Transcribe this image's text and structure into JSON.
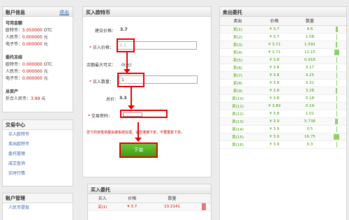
{
  "account": {
    "title": "账户信息",
    "logout": "退出",
    "avail_title": "可用金额",
    "avail_rows": [
      {
        "label": "欧特币：",
        "value": "5.050000",
        "unit": "OTC"
      },
      {
        "label": "人民币：",
        "value": "0.000000",
        "unit": "元"
      },
      {
        "label": "电子币：",
        "value": "0.000000",
        "unit": "元"
      }
    ],
    "frozen_title": "委托冻结",
    "frozen_rows": [
      {
        "label": "欧特币：",
        "value": "0.000000",
        "unit": "OTC"
      },
      {
        "label": "人民币：",
        "value": "0.000000",
        "unit": "元"
      },
      {
        "label": "电子币：",
        "value": "0.000000",
        "unit": "元"
      }
    ],
    "total_title": "总资产",
    "total_label": "折合人民币：",
    "total_value": "3.99",
    "total_unit": "元"
  },
  "trade_center": {
    "title": "交易中心",
    "items": [
      "买入欧特币",
      "卖出欧特币",
      "委托管理",
      "成交查询",
      "实时行情"
    ]
  },
  "account_mgmt": {
    "title": "账户管理",
    "items": [
      "人民币提现"
    ]
  },
  "buy_form": {
    "title": "买入欧特币",
    "suggest_label": "建议价格：",
    "suggest_value": "3.7",
    "price_label": "买入价格：",
    "price_value": "3.3",
    "max_label": "余额最大可买：",
    "max_value": "0(元)",
    "qty_label": "买入数量：",
    "qty_value": "1",
    "total_label": "总价：",
    "total_value": "3.3",
    "pwd_label": "交易密码：",
    "notice": "您下的单笔单都会被系统处理，请您谨慎下单，不要重复下单。",
    "submit": "下单"
  },
  "buy_orders": {
    "title": "买入委托",
    "headers": [
      "买入",
      "价格",
      "数量"
    ],
    "rows": [
      {
        "name": "买(1)",
        "price": "¥ 3.7",
        "qty": "13.2141"
      }
    ]
  },
  "sell_orders": {
    "title": "卖出委托",
    "headers": [
      "卖出",
      "价格",
      "数量"
    ],
    "rows": [
      {
        "name": "卖(1)",
        "price": "¥ 3.7",
        "qty": "4.6"
      },
      {
        "name": "卖(2)",
        "price": "¥ 3.7",
        "qty": "1.08"
      },
      {
        "name": "卖(3)",
        "price": "¥ 3.71",
        "qty": "1.592"
      },
      {
        "name": "卖(4)",
        "price": "¥ 3.71",
        "qty": "12.15"
      },
      {
        "name": "卖(5)",
        "price": "¥ 3.8",
        "qty": "0.918"
      },
      {
        "name": "卖(6)",
        "price": "¥ 3.8",
        "qty": "0.17"
      },
      {
        "name": "卖(7)",
        "price": "¥ 3.8",
        "qty": "0.25"
      },
      {
        "name": "卖(8)",
        "price": "¥ 3.8",
        "qty": "0.31"
      },
      {
        "name": "卖(9)",
        "price": "¥ 3.8",
        "qty": "3.28"
      },
      {
        "name": "卖(10)",
        "price": "¥ 3.8",
        "qty": "0.18"
      },
      {
        "name": "卖(11)",
        "price": "¥ 3.89",
        "qty": "0.19"
      },
      {
        "name": "卖(12)",
        "price": "¥ 3.8",
        "qty": "1.01"
      },
      {
        "name": "卖(13)",
        "price": "¥ 3.9",
        "qty": "5.738"
      },
      {
        "name": "卖(14)",
        "price": "¥ 3.9",
        "qty": "0.5"
      },
      {
        "name": "卖(15)",
        "price": "¥ 3.9",
        "qty": "16.75"
      },
      {
        "name": "卖(16)",
        "price": "¥ 3.9",
        "qty": "0.3"
      }
    ]
  },
  "colors": {
    "accent_red": "#e30000",
    "link_blue": "#3a66b0",
    "sell_green": "#3a9a00",
    "btn_green": "#4caf1f"
  }
}
